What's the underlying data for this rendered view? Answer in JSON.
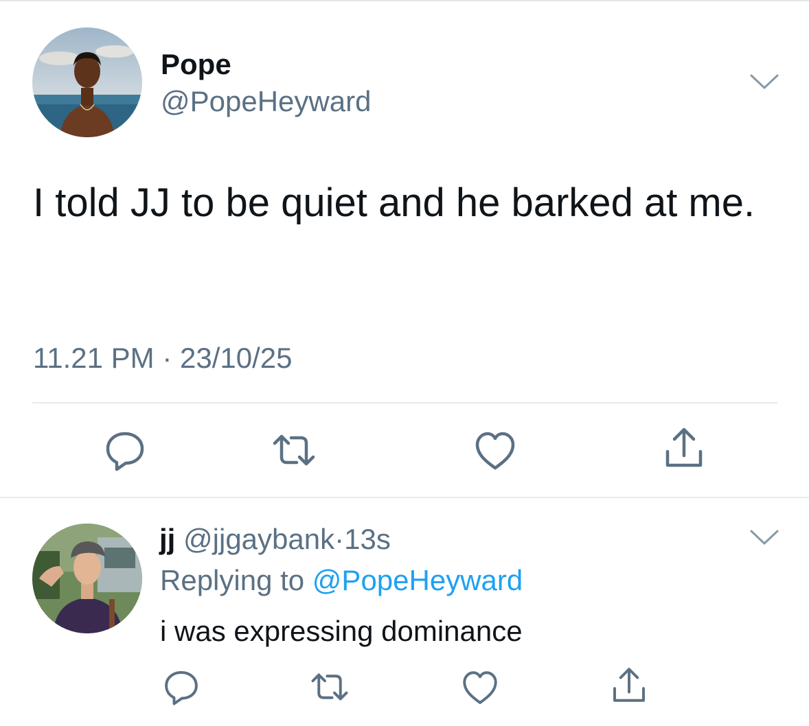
{
  "tweet": {
    "display_name": "Pope",
    "handle": "@PopeHeyward",
    "text": "I told JJ to be quiet and he barked at me.",
    "timestamp": "11.21 PM · 23/10/25",
    "avatar": "avatar-photo-pope",
    "actions": [
      "reply-icon",
      "retweet-icon",
      "like-icon",
      "share-icon"
    ],
    "menu_icon": "chevron-down-icon"
  },
  "reply": {
    "display_name": "jj",
    "handle": "@jjgaybank",
    "separator": "·",
    "time": "13s",
    "replying_prefix": "Replying to",
    "replying_to": "@PopeHeyward",
    "text": "i was expressing dominance",
    "avatar": "avatar-photo-jj",
    "actions": [
      "reply-icon",
      "retweet-icon",
      "like-icon",
      "share-icon"
    ],
    "menu_icon": "chevron-down-icon"
  },
  "colors": {
    "text_primary": "#0f1419",
    "text_secondary": "#5b7083",
    "link": "#1da1f2",
    "divider": "#e6ecf0"
  }
}
